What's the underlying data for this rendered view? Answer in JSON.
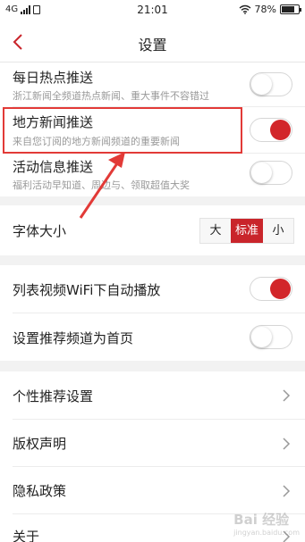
{
  "status_bar": {
    "network": "4G",
    "time": "21:01",
    "battery": "78%",
    "battery_level": 0.78
  },
  "nav": {
    "title": "设置"
  },
  "push_rows": [
    {
      "label": "每日热点推送",
      "sub": "浙江新闻全频道热点新闻、重大事件不容错过",
      "on": false
    },
    {
      "label": "地方新闻推送",
      "sub": "来自您订阅的地方新闻频道的重要新闻",
      "on": true
    },
    {
      "label": "活动信息推送",
      "sub": "福利活动早知道、周边与、领取超值大奖",
      "on": false
    }
  ],
  "font_size": {
    "label": "字体大小",
    "options": [
      "大",
      "标准",
      "小"
    ],
    "selected": "标准"
  },
  "play_rows": [
    {
      "label": "列表视频WiFi下自动播放",
      "on": true
    },
    {
      "label": "设置推荐频道为首页",
      "on": false
    }
  ],
  "link_rows": [
    {
      "label": "个性推荐设置"
    },
    {
      "label": "版权声明"
    },
    {
      "label": "隐私政策"
    },
    {
      "label": "关于"
    }
  ],
  "colors": {
    "accent": "#d2262a",
    "highlight": "#e23a37"
  },
  "watermark": {
    "text": "Bai 经验",
    "sub": "jingyan.baidu.com"
  }
}
